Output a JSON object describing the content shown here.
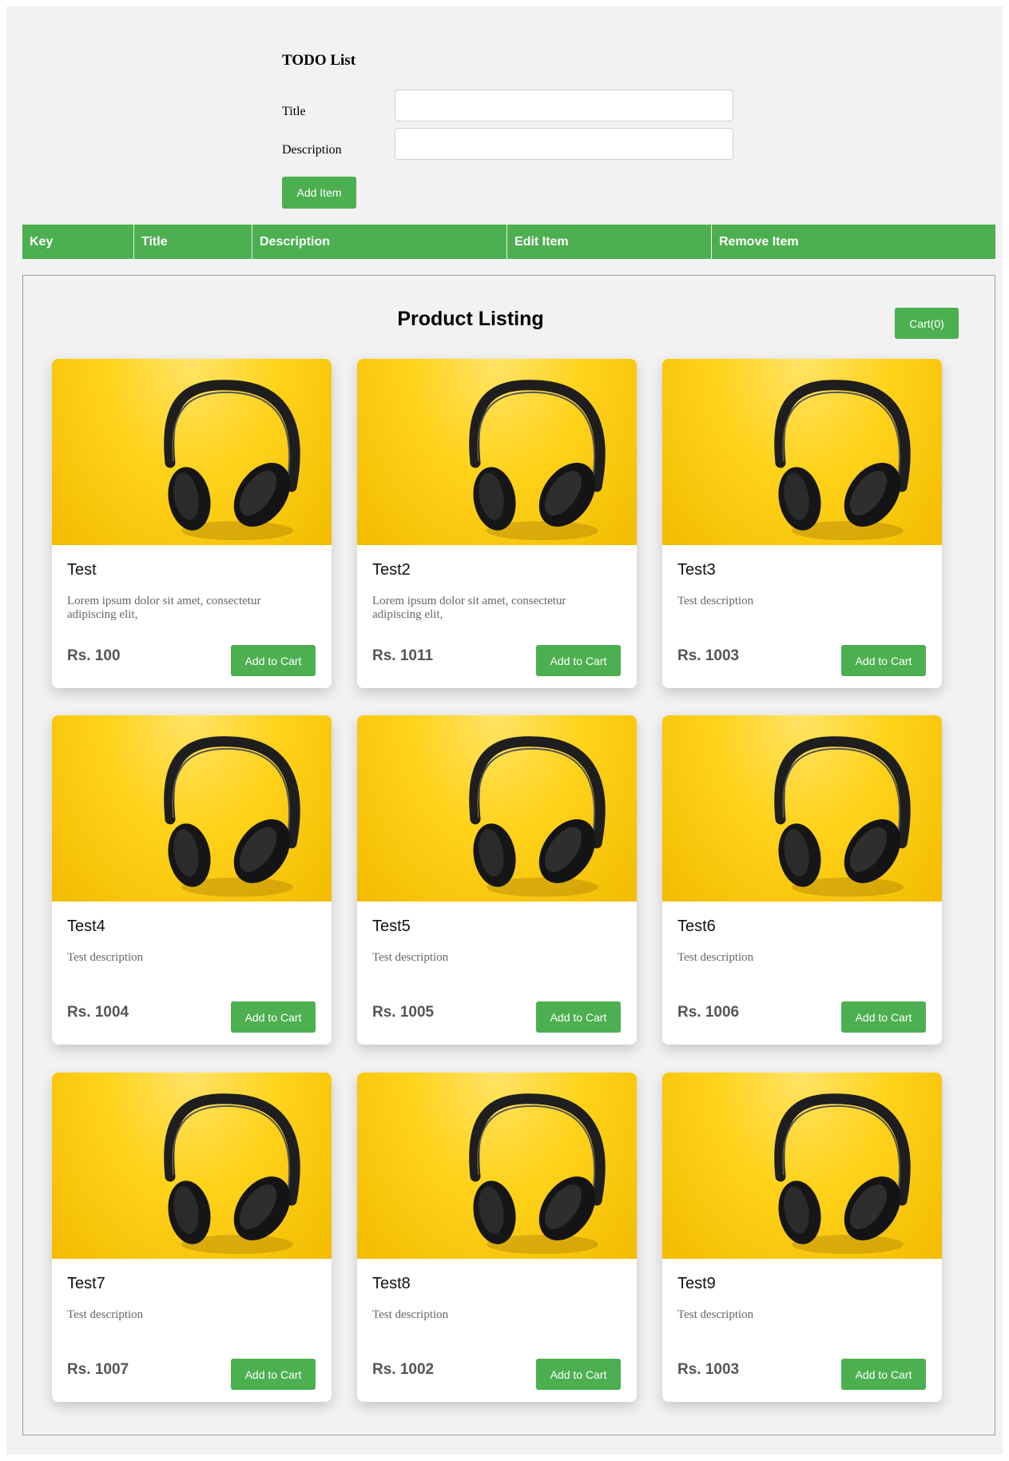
{
  "todo": {
    "heading": "TODO List",
    "title_label": "Title",
    "description_label": "Description",
    "title_value": "",
    "description_value": "",
    "add_button": "Add Item",
    "table_headers": [
      "Key",
      "Title",
      "Description",
      "Edit Item",
      "Remove Item"
    ]
  },
  "products": {
    "heading": "Product Listing",
    "cart_button": "Cart(0)",
    "add_to_cart_label": "Add to Cart",
    "items": [
      {
        "title": "Test",
        "description": "Lorem ipsum dolor sit amet, consectetur adipiscing elit,",
        "price": "Rs. 100"
      },
      {
        "title": "Test2",
        "description": "Lorem ipsum dolor sit amet, consectetur adipiscing elit,",
        "price": "Rs. 1011"
      },
      {
        "title": "Test3",
        "description": "Test description",
        "price": "Rs. 1003"
      },
      {
        "title": "Test4",
        "description": "Test description",
        "price": "Rs. 1004"
      },
      {
        "title": "Test5",
        "description": "Test description",
        "price": "Rs. 1005"
      },
      {
        "title": "Test6",
        "description": "Test description",
        "price": "Rs. 1006"
      },
      {
        "title": "Test7",
        "description": "Test description",
        "price": "Rs. 1007"
      },
      {
        "title": "Test8",
        "description": "Test description",
        "price": "Rs. 1002"
      },
      {
        "title": "Test9",
        "description": "Test description",
        "price": "Rs. 1003"
      }
    ],
    "image_subject": "headphones-image"
  },
  "colors": {
    "accent": "#4caf50",
    "background": "#f2f2f2",
    "product_image_bg": "#ffd21a"
  }
}
